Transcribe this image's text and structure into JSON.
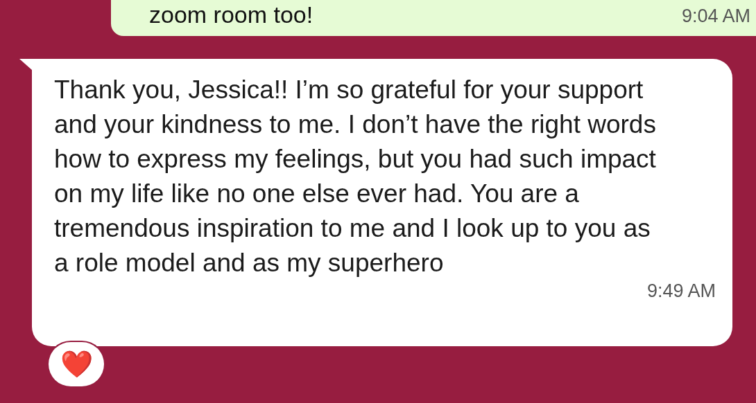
{
  "messages": [
    {
      "kind": "sent",
      "text": "zoom room too!",
      "time": "9:04 AM"
    },
    {
      "kind": "received",
      "text": "Thank you, Jessica!! I’m so grateful for your support and your kindness to me. I don’t have the right words how to express my feelings, but you had such impact on my life like no one else ever had. You are a tremendous inspiration to me and I look up to you as a role model and as my superhero",
      "time": "9:49 AM",
      "reaction": "❤️"
    }
  ]
}
